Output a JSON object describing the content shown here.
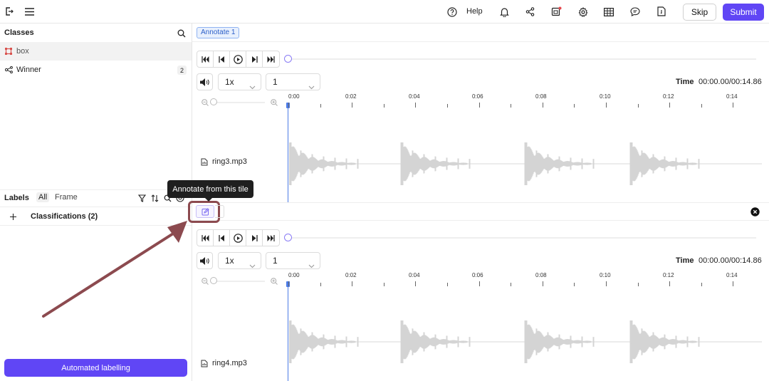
{
  "header": {
    "help_label": "Help",
    "skip_label": "Skip",
    "submit_label": "Submit",
    "accent": "#6046f5",
    "notification_dot": "#e5484d"
  },
  "sidebar": {
    "classes_title": "Classes",
    "classes": [
      {
        "label": "box",
        "icon": "bounding-box-icon",
        "color": "#d9534f"
      },
      {
        "label": "Winner",
        "icon": "classification-icon",
        "count": "2"
      }
    ],
    "labels_title": "Labels",
    "label_filters": [
      "All",
      "Frame"
    ],
    "classifications_label": "Classifications (2)",
    "automated_label": "Automated labelling"
  },
  "main": {
    "tab_label": "Annotate 1",
    "tooltip": "Annotate from this tile",
    "tiles": [
      {
        "file": "ring3.mp3",
        "speed": "1x",
        "channel": "1",
        "time_label": "Time",
        "time_value": "00:00.00/00:14.86",
        "ticks": [
          "0:00",
          "0:02",
          "0:04",
          "0:06",
          "0:08",
          "0:10",
          "0:12",
          "0:14"
        ]
      },
      {
        "file": "ring4.mp3",
        "speed": "1x",
        "channel": "1",
        "time_label": "Time",
        "time_value": "00:00.00/00:14.86",
        "ticks": [
          "0:00",
          "0:02",
          "0:04",
          "0:06",
          "0:08",
          "0:10",
          "0:12",
          "0:14"
        ]
      }
    ]
  }
}
